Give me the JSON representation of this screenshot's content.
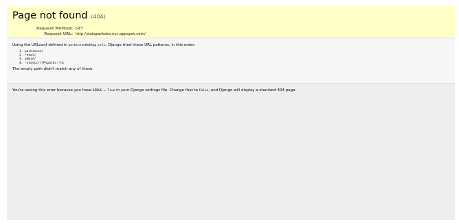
{
  "summary": {
    "title": "Page not found",
    "status_code": "(404)",
    "method_label": "Request Method:",
    "method_value": "GET",
    "url_label": "Request URL:",
    "url_value": "http://dataparkdev.ey.r.appspot.com/"
  },
  "info": {
    "intro_before": "Using the URLconf defined in ",
    "urlconf": "parkinsonWebApp.urls",
    "intro_after": ", Django tried these URL patterns, in this order:",
    "patterns": [
      "parkinson/",
      "^html/",
      "admin/",
      "^static/(?P<path>.*)$"
    ],
    "empty_path_note": "The empty path didn't match any of these."
  },
  "explanation": {
    "part1": "You're seeing this error because you have ",
    "code1": "DEBUG = True",
    "part2": " in your Django settings file. Change that to ",
    "code2": "False",
    "part3": ", and Django will display a standard 404 page."
  }
}
